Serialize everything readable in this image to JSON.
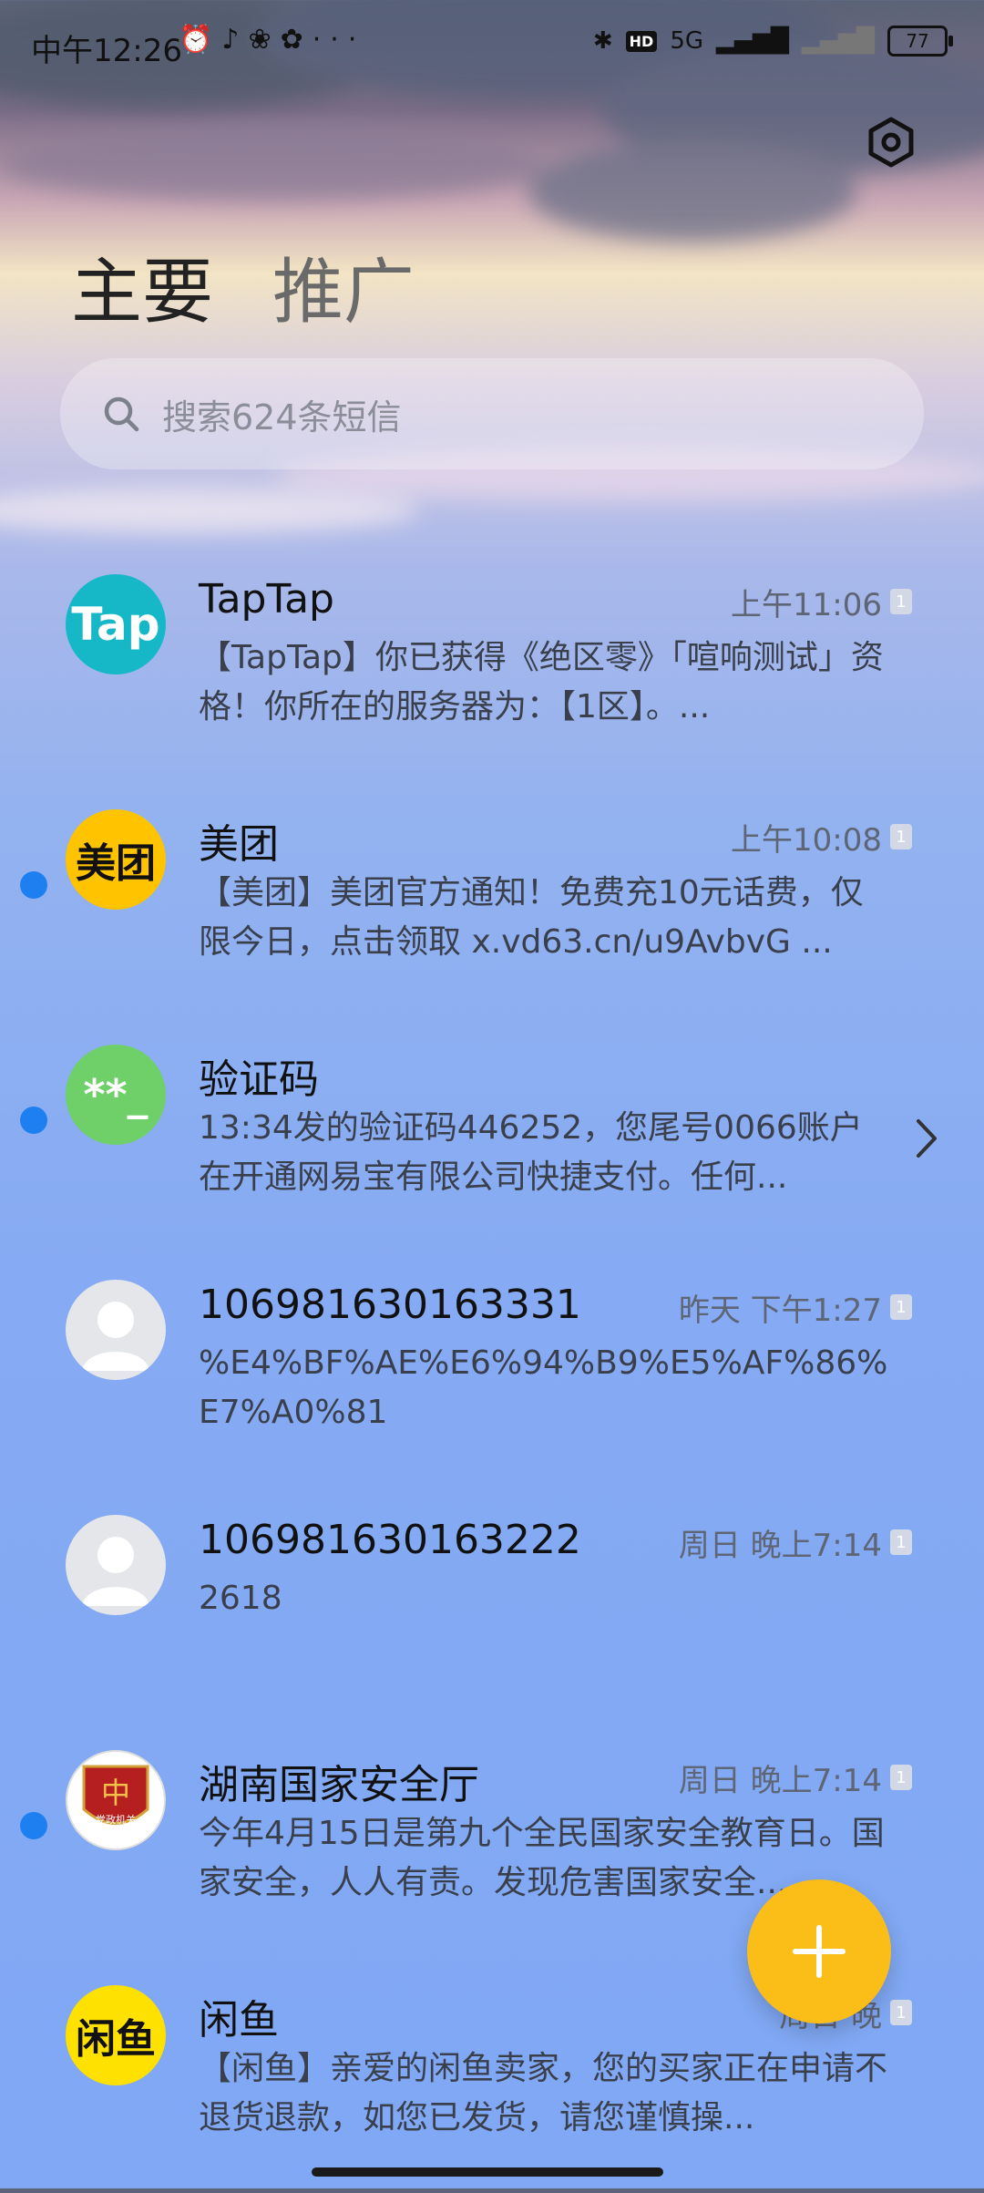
{
  "status_bar": {
    "time": "中午12:26",
    "icons": [
      "alarm-icon",
      "tiktok-icon",
      "app-icon",
      "app-icon",
      "more-icon"
    ],
    "network": "5G",
    "hd": "HD",
    "battery": "77"
  },
  "tabs": [
    {
      "label": "主要",
      "active": true
    },
    {
      "label": "推广",
      "active": false
    }
  ],
  "search": {
    "placeholder": "搜索624条短信"
  },
  "conversations": [
    {
      "name": "TapTap",
      "time": "上午11:06",
      "badge": "1",
      "unread": false,
      "avatar_text": "Tap",
      "avatar_color": "#16b8c8",
      "preview": "【TapTap】你已获得《绝区零》「喧响测试」资格！你所在的服务器为：【1区】。..."
    },
    {
      "name": "美团",
      "time": "上午10:08",
      "badge": "1",
      "unread": true,
      "avatar_text": "美团",
      "avatar_color": "#ffc300",
      "preview": "【美团】美团官方通知！免费充10元话费，仅限今日，点击领取 x.vd63.cn/u9AvbvG ..."
    },
    {
      "name": "验证码",
      "time": "",
      "badge": "",
      "unread": true,
      "avatar_text": "**_",
      "avatar_color": "#6fd06a",
      "preview": "13:34发的验证码446252，您尾号0066账户在开通网易宝有限公司快捷支付。任何..."
    },
    {
      "name": "106981630163331",
      "time": "昨天 下午1:27",
      "badge": "1",
      "unread": false,
      "avatar_text": "",
      "avatar_color": "#e4e6ea",
      "preview": "%E4%BF%AE%E6%94%B9%E5%AF%86%E7%A0%81"
    },
    {
      "name": "106981630163222",
      "time": "周日 晚上7:14",
      "badge": "1",
      "unread": false,
      "avatar_text": "",
      "avatar_color": "#e4e6ea",
      "preview": "2618"
    },
    {
      "name": "湖南国家安全厅",
      "time": "周日 晚上7:14",
      "badge": "1",
      "unread": true,
      "avatar_text": "党政机关",
      "avatar_color": "#ffffff",
      "preview": "今年4月15日是第九个全民国家安全教育日。国家安全，人人有责。发现危害国家安全..."
    },
    {
      "name": "闲鱼",
      "time": "周日 晚",
      "badge": "1",
      "unread": false,
      "avatar_text": "闲鱼",
      "avatar_color": "#ffe100",
      "preview": "【闲鱼】亲爱的闲鱼卖家，您的买家正在申请不退货退款，如您已发货，请您谨慎操..."
    }
  ],
  "accent_color": "#fbbe18"
}
